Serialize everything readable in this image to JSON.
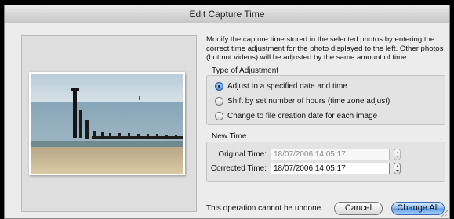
{
  "window": {
    "title": "Edit Capture Time"
  },
  "description": "Modify the capture time stored in the selected photos by entering the correct time adjustment for the photo displayed to the left. Other photos (but not videos) will be adjusted by the same amount of time.",
  "adjustment": {
    "label": "Type of Adjustment",
    "options": [
      {
        "label": "Adjust to a specified date and time",
        "selected": true
      },
      {
        "label": "Shift by set number of hours (time zone adjust)",
        "selected": false
      },
      {
        "label": "Change to file creation date for each image",
        "selected": false
      }
    ]
  },
  "new_time": {
    "label": "New Time",
    "original_label": "Original Time:",
    "original_value": "18/07/2006 14:05:17",
    "corrected_label": "Corrected Time:",
    "corrected_value": "18/07/2006 14:05:17"
  },
  "warning": "This operation cannot be undone.",
  "buttons": {
    "cancel": "Cancel",
    "change_all": "Change All"
  },
  "colors": {
    "accent": "#5c9ae3",
    "background": "#ececec"
  }
}
